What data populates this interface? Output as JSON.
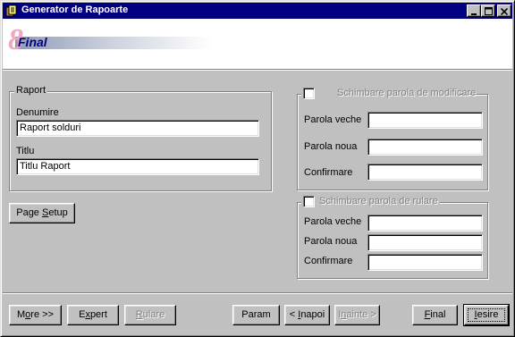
{
  "window": {
    "title": "Generator de Rapoarte",
    "minimize": "_",
    "maximize": "□",
    "close": "✕"
  },
  "wizard": {
    "step_number": "8",
    "step_title": "Final"
  },
  "raport": {
    "legend": "Raport",
    "denumire_label": "Denumire",
    "denumire_value": "Raport solduri",
    "titlu_label": "Titlu",
    "titlu_value": "Titlu Raport"
  },
  "page_setup": {
    "pre": "Page ",
    "u": "S",
    "post": "etup"
  },
  "modificare": {
    "checkbox_label": "Schimbare parola de modificare",
    "checked": false,
    "parola_veche_label": "Parola veche",
    "parola_veche_value": "",
    "parola_noua_label": "Parola noua",
    "parola_noua_value": "",
    "confirmare_label": "Confirmare",
    "confirmare_value": ""
  },
  "rulare": {
    "checkbox_label": "Schimbare parola de rulare",
    "checked": false,
    "parola_veche_label": "Parola veche",
    "parola_veche_value": "",
    "parola_noua_label": "Parola noua",
    "parola_noua_value": "",
    "confirmare_label": "Confirmare",
    "confirmare_value": ""
  },
  "buttons": {
    "more": {
      "pre": "M",
      "u": "o",
      "post": "re >>"
    },
    "expert": {
      "pre": "E",
      "u": "x",
      "post": "pert"
    },
    "rulare": {
      "pre": "",
      "u": "R",
      "post": "ulare",
      "enabled": false
    },
    "param": {
      "pre": "Param",
      "u": "",
      "post": ""
    },
    "inapoi": {
      "pre": "< ",
      "u": "I",
      "post": "napoi"
    },
    "inainte": {
      "pre": "I",
      "u": "n",
      "post": "ainte >",
      "enabled": false
    },
    "final": {
      "pre": "",
      "u": "F",
      "post": "inal"
    },
    "iesire": {
      "pre": "",
      "u": "I",
      "post": "esire"
    }
  }
}
